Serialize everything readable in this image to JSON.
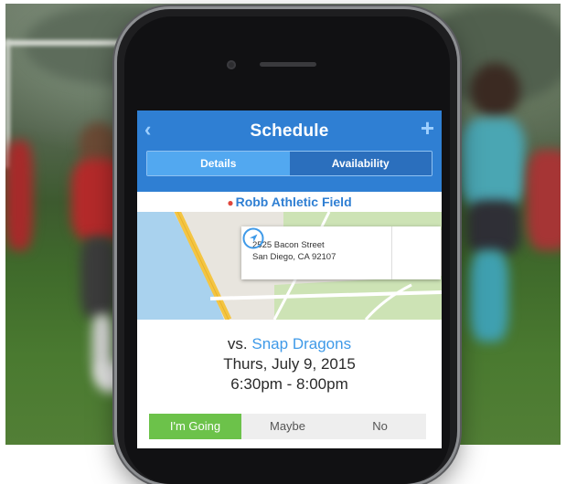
{
  "nav": {
    "back_glyph": "‹",
    "title": "Schedule",
    "add_glyph": "+",
    "tabs": [
      {
        "label": "Details",
        "active": true
      },
      {
        "label": "Availability",
        "active": false
      }
    ]
  },
  "location": {
    "pin_glyph": "●",
    "name": "Robb Athletic Field"
  },
  "map": {
    "address_line1": "2525 Bacon Street",
    "address_line2": "San Diego, CA 92107",
    "directions_icon": "navigation-arrow-icon"
  },
  "event": {
    "vs_prefix": "vs.",
    "opponent": "Snap Dragons",
    "date": "Thurs, July 9, 2015",
    "time": "6:30pm - 8:00pm"
  },
  "rsvp": {
    "options": [
      {
        "label": "I'm Going",
        "selected": true
      },
      {
        "label": "Maybe",
        "selected": false
      },
      {
        "label": "No",
        "selected": false
      }
    ]
  },
  "colors": {
    "nav_blue": "#2f7fd3",
    "accent_blue": "#3f9ae8",
    "going_green": "#6cc24a",
    "pin_red": "#e0473c"
  }
}
